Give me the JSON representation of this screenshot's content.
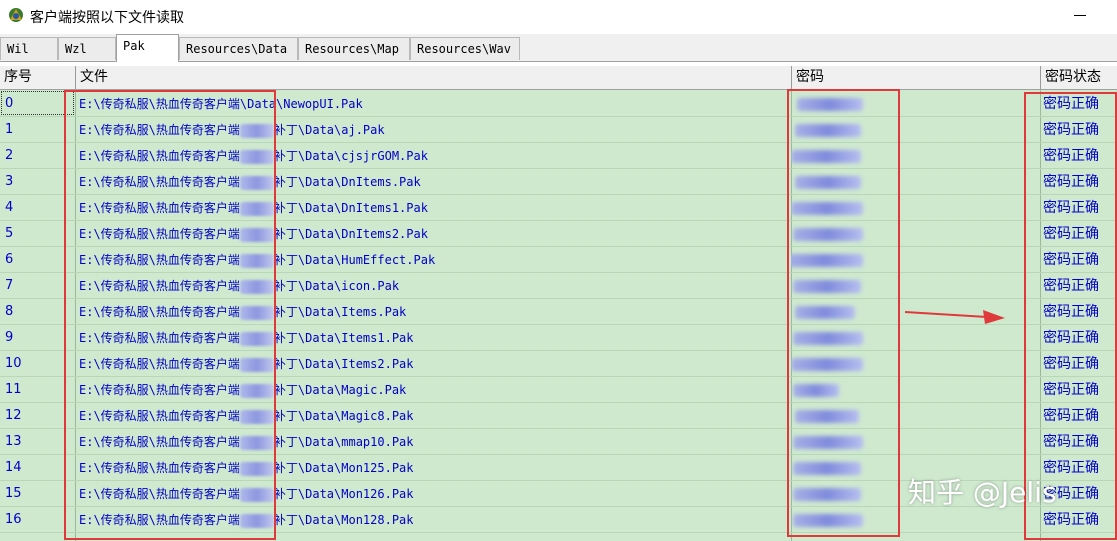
{
  "window": {
    "title": "客户端按照以下文件读取"
  },
  "tabs": [
    {
      "label": "Wil"
    },
    {
      "label": "Wzl"
    },
    {
      "label": "Pak"
    },
    {
      "label": "Resources\\Data"
    },
    {
      "label": "Resources\\Map"
    },
    {
      "label": "Resources\\Wav"
    }
  ],
  "table": {
    "columns": [
      "序号",
      "文件",
      "密码",
      "密码状态"
    ],
    "rows": [
      {
        "index": "0",
        "file_prefix": "E:\\传奇私服\\热血传奇客户端",
        "file_suffix": "\\Data\\NewopUI.Pak",
        "status": "密码正确"
      },
      {
        "index": "1",
        "file_prefix": "E:\\传奇私服\\热血传奇客户端",
        "file_suffix": "补丁\\Data\\aj.Pak",
        "status": "密码正确"
      },
      {
        "index": "2",
        "file_prefix": "E:\\传奇私服\\热血传奇客户端",
        "file_suffix": "补丁\\Data\\cjsjrGOM.Pak",
        "status": "密码正确"
      },
      {
        "index": "3",
        "file_prefix": "E:\\传奇私服\\热血传奇客户端",
        "file_suffix": "补丁\\Data\\DnItems.Pak",
        "status": "密码正确"
      },
      {
        "index": "4",
        "file_prefix": "E:\\传奇私服\\热血传奇客户端",
        "file_suffix": "补丁\\Data\\DnItems1.Pak",
        "status": "密码正确"
      },
      {
        "index": "5",
        "file_prefix": "E:\\传奇私服\\热血传奇客户端",
        "file_suffix": "补丁\\Data\\DnItems2.Pak",
        "status": "密码正确"
      },
      {
        "index": "6",
        "file_prefix": "E:\\传奇私服\\热血传奇客户端",
        "file_suffix": "补丁\\Data\\HumEffect.Pak",
        "status": "密码正确"
      },
      {
        "index": "7",
        "file_prefix": "E:\\传奇私服\\热血传奇客户端",
        "file_suffix": "补丁\\Data\\icon.Pak",
        "status": "密码正确"
      },
      {
        "index": "8",
        "file_prefix": "E:\\传奇私服\\热血传奇客户端",
        "file_suffix": "补丁\\Data\\Items.Pak",
        "status": "密码正确"
      },
      {
        "index": "9",
        "file_prefix": "E:\\传奇私服\\热血传奇客户端",
        "file_suffix": "补丁\\Data\\Items1.Pak",
        "status": "密码正确"
      },
      {
        "index": "10",
        "file_prefix": "E:\\传奇私服\\热血传奇客户端",
        "file_suffix": "补丁\\Data\\Items2.Pak",
        "status": "密码正确"
      },
      {
        "index": "11",
        "file_prefix": "E:\\传奇私服\\热血传奇客户端",
        "file_suffix": "补丁\\Data\\Magic.Pak",
        "status": "密码正确"
      },
      {
        "index": "12",
        "file_prefix": "E:\\传奇私服\\热血传奇客户端",
        "file_suffix": "补丁\\Data\\Magic8.Pak",
        "status": "密码正确"
      },
      {
        "index": "13",
        "file_prefix": "E:\\传奇私服\\热血传奇客户端",
        "file_suffix": "补丁\\Data\\mmap10.Pak",
        "status": "密码正确"
      },
      {
        "index": "14",
        "file_prefix": "E:\\传奇私服\\热血传奇客户端",
        "file_suffix": "补丁\\Data\\Mon125.Pak",
        "status": "密码正确"
      },
      {
        "index": "15",
        "file_prefix": "E:\\传奇私服\\热血传奇客户端",
        "file_suffix": "补丁\\Data\\Mon126.Pak",
        "status": "密码正确"
      },
      {
        "index": "16",
        "file_prefix": "E:\\传奇私服\\热血传奇客户端",
        "file_suffix": "补丁\\Data\\Mon128.Pak",
        "status": "密码正确"
      }
    ]
  },
  "watermark": {
    "text": "知乎 @Jelis"
  },
  "colors": {
    "row_bg": "#cfe9cf",
    "text": "#0000cc",
    "highlight": "#e0393b"
  }
}
